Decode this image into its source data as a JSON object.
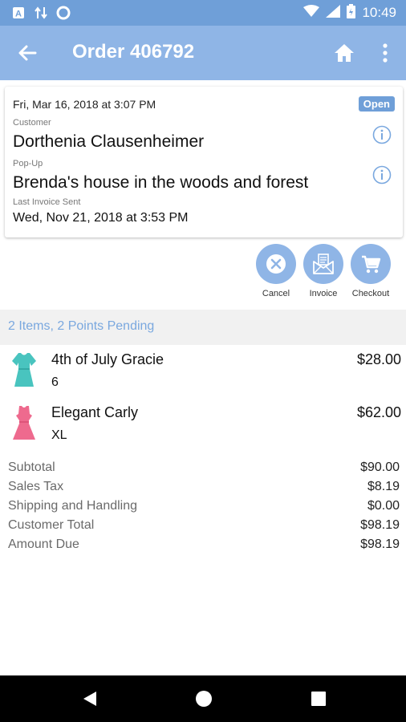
{
  "status_bar": {
    "time": "10:49",
    "icons": [
      "app-a-icon",
      "data-sync-icon",
      "circle-icon",
      "wifi-icon",
      "signal-icon",
      "battery-icon"
    ]
  },
  "app_bar": {
    "title": "Order 406792",
    "icons": [
      "back-arrow-icon",
      "home-icon",
      "more-vert-icon"
    ]
  },
  "order_card": {
    "date": "Fri, Mar 16, 2018 at 3:07 PM",
    "status": "Open",
    "customer_label": "Customer",
    "customer_name": "Dorthenia Clausenheimer",
    "popup_label": "Pop-Up",
    "popup_name": "Brenda's house in the woods and forest",
    "last_invoice_label": "Last Invoice Sent",
    "last_invoice_date": "Wed, Nov 21, 2018 at 3:53 PM"
  },
  "actions": [
    {
      "label": "Cancel",
      "icon": "cancel-circle-icon"
    },
    {
      "label": "Invoice",
      "icon": "envelope-icon"
    },
    {
      "label": "Checkout",
      "icon": "cart-icon"
    }
  ],
  "summary": "2 Items, 2 Points Pending",
  "items": [
    {
      "name": "4th of July Gracie",
      "size": "6",
      "price": "$28.00",
      "icon": "teal-dress-icon",
      "color": "#49c4bf"
    },
    {
      "name": "Elegant Carly",
      "size": "XL",
      "price": "$62.00",
      "icon": "pink-dress-icon",
      "color": "#ee6a8e"
    }
  ],
  "totals": [
    {
      "label": "Subtotal",
      "value": "$90.00"
    },
    {
      "label": "Sales Tax",
      "value": "$8.19"
    },
    {
      "label": "Shipping and Handling",
      "value": "$0.00"
    },
    {
      "label": "Customer Total",
      "value": "$98.19"
    },
    {
      "label": "Amount Due",
      "value": "$98.19"
    }
  ],
  "nav": [
    "back-triangle-icon",
    "home-circle-icon",
    "recents-square-icon"
  ],
  "colors": {
    "status_bar": "#6f9fd8",
    "app_bar": "#8fb5e6",
    "accent": "#7aa8df"
  }
}
